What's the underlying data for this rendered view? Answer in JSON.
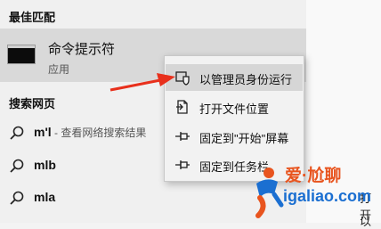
{
  "sections": {
    "best_match": "最佳匹配",
    "web_search": "搜索网页"
  },
  "best_match_item": {
    "name": "命令提示符",
    "type": "应用",
    "icon": "command-prompt-icon"
  },
  "web_results": [
    {
      "query": "m'l",
      "hint": " - 查看网络搜索结果",
      "icon": "search-icon"
    },
    {
      "query": "mlb",
      "hint": "",
      "icon": "search-icon"
    },
    {
      "query": "mla",
      "hint": "",
      "icon": "search-icon"
    }
  ],
  "context_menu": {
    "items": [
      {
        "label": "以管理员身份运行",
        "icon": "shield-icon",
        "highlighted": true
      },
      {
        "label": "打开文件位置",
        "icon": "open-file-icon",
        "highlighted": false
      },
      {
        "label": "固定到\"开始\"屏幕",
        "icon": "pin-icon",
        "highlighted": false
      },
      {
        "label": "固定到任务栏",
        "icon": "pin-icon",
        "highlighted": false
      }
    ]
  },
  "right_pane": {
    "partial_texts": [
      "打开",
      "以"
    ]
  },
  "annotation": {
    "arrow_color": "#e8301c"
  },
  "watermark": {
    "title": "爱·尬聊",
    "url": "igaliao.com"
  },
  "colors": {
    "selected_row": "#d9d9d9",
    "menu_hover": "#d6d6d6",
    "watermark_orange": "#e8541e",
    "watermark_blue": "#1b6fd1"
  }
}
